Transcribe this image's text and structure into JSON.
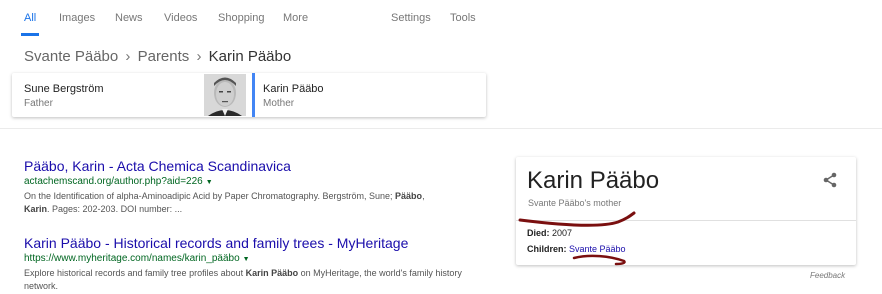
{
  "tabs": {
    "all": "All",
    "images": "Images",
    "news": "News",
    "videos": "Videos",
    "shopping": "Shopping",
    "more": "More",
    "settings": "Settings",
    "tools": "Tools"
  },
  "breadcrumb": {
    "item1": "Svante Pääbo",
    "sep": "›",
    "item2": "Parents",
    "current": "Karin Pääbo"
  },
  "carousel": {
    "cards": [
      {
        "name": "Sune Bergström",
        "relation": "Father"
      },
      {
        "name": "Karin Pääbo",
        "relation": "Mother"
      }
    ]
  },
  "results": [
    {
      "title": "Pääbo, Karin - Acta Chemica Scandinavica",
      "url": "actachemscand.org/author.php?aid=226",
      "snippet_line1": "On the Identification of alpha-Aminoadipic Acid by Paper Chromatography. Bergström, Sune; ",
      "snippet_bold1": "Pääbo",
      "snippet_comma": ", ",
      "snippet_bold2": "Karin",
      "snippet_line2": ". Pages: 202-203. DOI number: ..."
    },
    {
      "title": "Karin Pääbo - Historical records and family trees - MyHeritage",
      "url": "https://www.myheritage.com/names/karin_pääbo",
      "snippet_pre": "Explore historical records and family tree profiles about ",
      "snippet_bold": "Karin Pääbo",
      "snippet_post": " on MyHeritage, the world's family history network."
    }
  ],
  "knowledge_panel": {
    "title": "Karin Pääbo",
    "subtitle": "Svante Pääbo's mother",
    "died_label": "Died:",
    "died_value": "2007",
    "children_label": "Children:",
    "children_value": "Svante Pääbo",
    "share_icon": "share-icon"
  },
  "feedback": "Feedback",
  "colors": {
    "accent": "#1a73e8",
    "link": "#1a0dab",
    "url": "#006621",
    "annotation": "#7a0f0f"
  }
}
